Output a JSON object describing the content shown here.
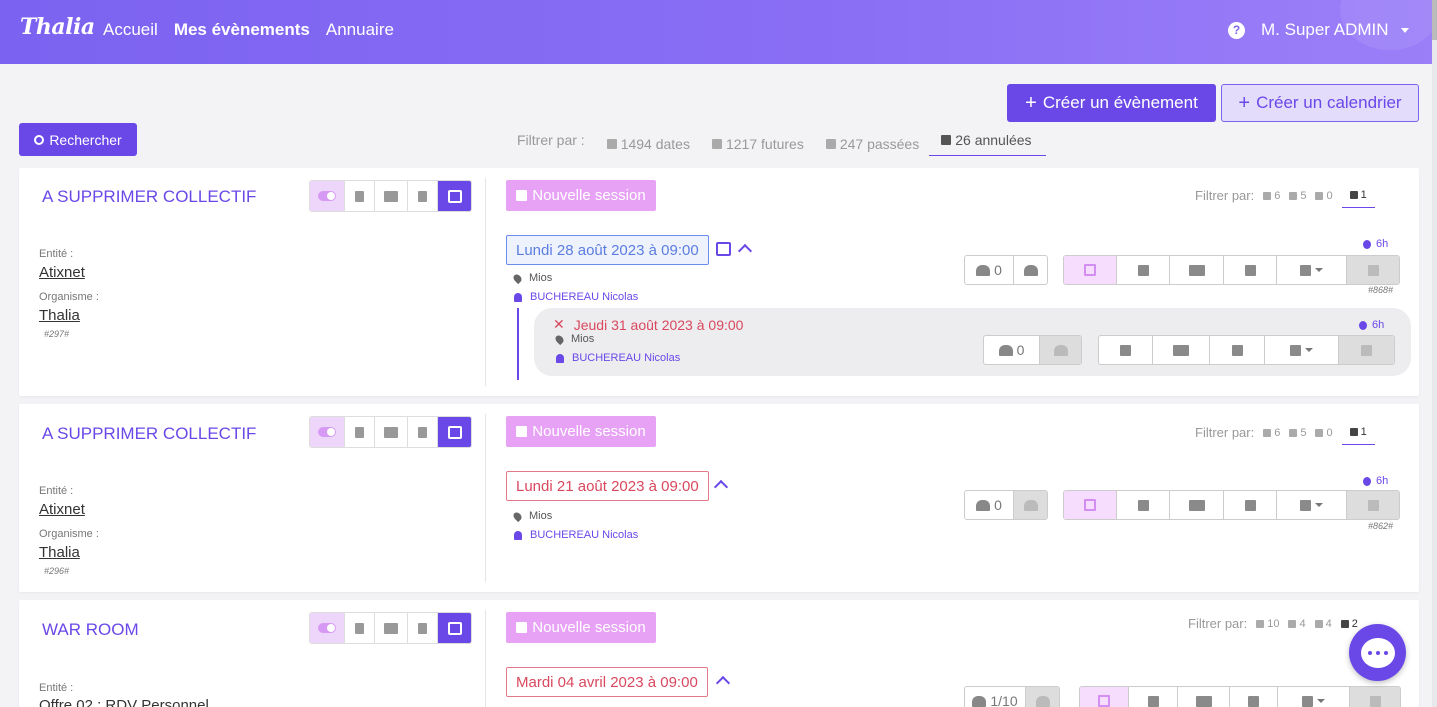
{
  "navbar": {
    "logo": "Thalia",
    "links": [
      "Accueil",
      "Mes évènements",
      "Annuaire"
    ],
    "help": "?",
    "user": "M. Super ADMIN"
  },
  "actions": {
    "create_event": "Créer un évènement",
    "create_calendar": "Créer un calendrier",
    "search": "Rechercher"
  },
  "filter": {
    "label": "Filtrer par :",
    "items": [
      "1494 dates",
      "1217 futures",
      "247 passées",
      "26 annulées"
    ]
  },
  "common": {
    "entity_label": "Entité :",
    "org_label": "Organisme :",
    "new_session": "Nouvelle session",
    "filter_label": "Filtrer par:",
    "duration": "6h"
  },
  "events": [
    {
      "title": "A SUPPRIMER COLLECTIF",
      "entity": "Atixnet",
      "org": "Thalia",
      "ref": "#297#",
      "filter_counts": [
        "6",
        "5",
        "0",
        "1"
      ],
      "session": {
        "date": "Lundi 28 août 2023 à 09:00",
        "place": "Mios",
        "person": "BUCHEREAU Nicolas",
        "count": "0",
        "ref": "#868#"
      },
      "sub": {
        "date": "Jeudi 31 août 2023 à 09:00",
        "place": "Mios",
        "person": "BUCHEREAU Nicolas",
        "count": "0",
        "duration": "6h"
      }
    },
    {
      "title": "A SUPPRIMER COLLECTIF",
      "entity": "Atixnet",
      "org": "Thalia",
      "ref": "#296#",
      "filter_counts": [
        "6",
        "5",
        "0",
        "1"
      ],
      "session": {
        "date": "Lundi 21 août 2023 à 09:00",
        "place": "Mios",
        "person": "BUCHEREAU Nicolas",
        "count": "0",
        "ref": "#862#"
      }
    },
    {
      "title": "WAR ROOM",
      "entity": "Offre 02 : RDV Personnel",
      "filter_counts": [
        "10",
        "4",
        "4",
        "2"
      ],
      "session": {
        "date": "Mardi 04 avril 2023 à 09:00",
        "count": "1/10"
      }
    }
  ],
  "colors": {
    "accent": "#6a48e8",
    "pink": "#e7a2f6",
    "cancel_red": "#d9485e"
  }
}
